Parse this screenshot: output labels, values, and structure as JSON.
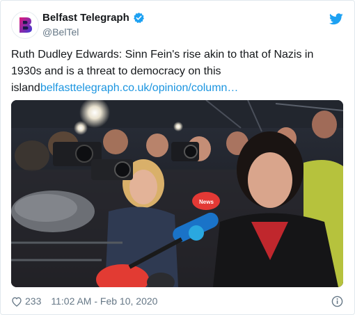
{
  "account": {
    "name": "Belfast Telegraph",
    "handle": "@BelTel",
    "logo_letter": "B",
    "verified_icon": "verified-badge-icon",
    "platform_icon": "twitter-bird-icon"
  },
  "tweet": {
    "text": "Ruth Dudley Edwards: Sinn Fein's rise akin to that of Nazis in 1930s and is a threat to democracy on this island",
    "link_text": "belfasttelegraph.co.uk/opinion/column…"
  },
  "media": {
    "description_icon": "news-photo",
    "microphone_label": "News"
  },
  "footer": {
    "like_count": "233",
    "timestamp": "11:02 AM - Feb 10, 2020",
    "like_icon": "heart-icon",
    "info_icon": "info-icon"
  },
  "colors": {
    "link": "#1b95e0",
    "twitter_blue": "#1da1f2",
    "secondary_text": "#657786",
    "logo_gradient_start": "#d6177f",
    "logo_gradient_end": "#3a3ad6"
  }
}
